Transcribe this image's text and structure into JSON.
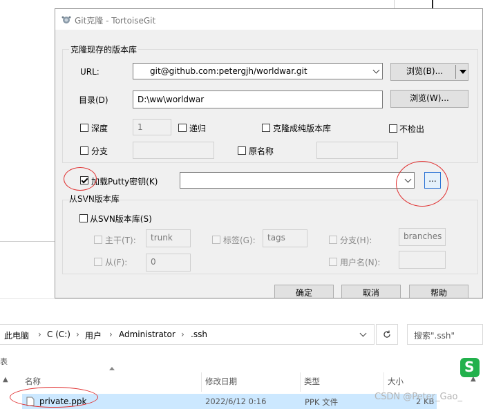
{
  "dialog": {
    "title": "Git克隆 - TortoiseGit",
    "group_clone": "克隆现存的版本库",
    "url_label": "URL:",
    "url_value": "git@github.com:petergjh/worldwar.git",
    "browse_b": "浏览(B)...",
    "dir_label": "目录(D)",
    "dir_value": "D:\\ww\\worldwar",
    "browse_w": "浏览(W)...",
    "depth_label": "深度",
    "depth_value": "1",
    "recursive_label": "递归",
    "bare_label": "克隆成纯版本库",
    "no_checkout_label": "不检出",
    "branch_label": "分支",
    "origin_label": "原名称",
    "putty_label": "加载Putty密钥(K)",
    "putty_value": "",
    "putty_browse": "...",
    "group_svn": "从SVN版本库",
    "svn_label": "从SVN版本库(S)",
    "trunk_label": "主干(T):",
    "trunk_value": "trunk",
    "tags_label": "标签(G):",
    "tags_value": "tags",
    "branch_h_label": "分支(H):",
    "branch_h_value": "branches",
    "from_label": "从(F):",
    "from_value": "0",
    "username_label": "用户名(N):",
    "ok": "确定",
    "cancel": "取消",
    "help": "帮助"
  },
  "explorer": {
    "breadcrumb": [
      "此电脑",
      "C (C:)",
      "用户",
      "Administrator",
      ".ssh"
    ],
    "search_placeholder": "搜索\".ssh\"",
    "columns": [
      "名称",
      "修改日期",
      "类型",
      "大小"
    ],
    "row": {
      "name": "private.ppk",
      "date": "2022/6/12 0:16",
      "type": "PPK 文件",
      "size": "2 KB"
    },
    "left_glyph": "表"
  },
  "watermark": "CSDN @Peter_Gao_",
  "colors": {
    "annotation": "#e03030",
    "selected_row": "#cce8ff",
    "putty_button_border": "#2a72d4"
  }
}
